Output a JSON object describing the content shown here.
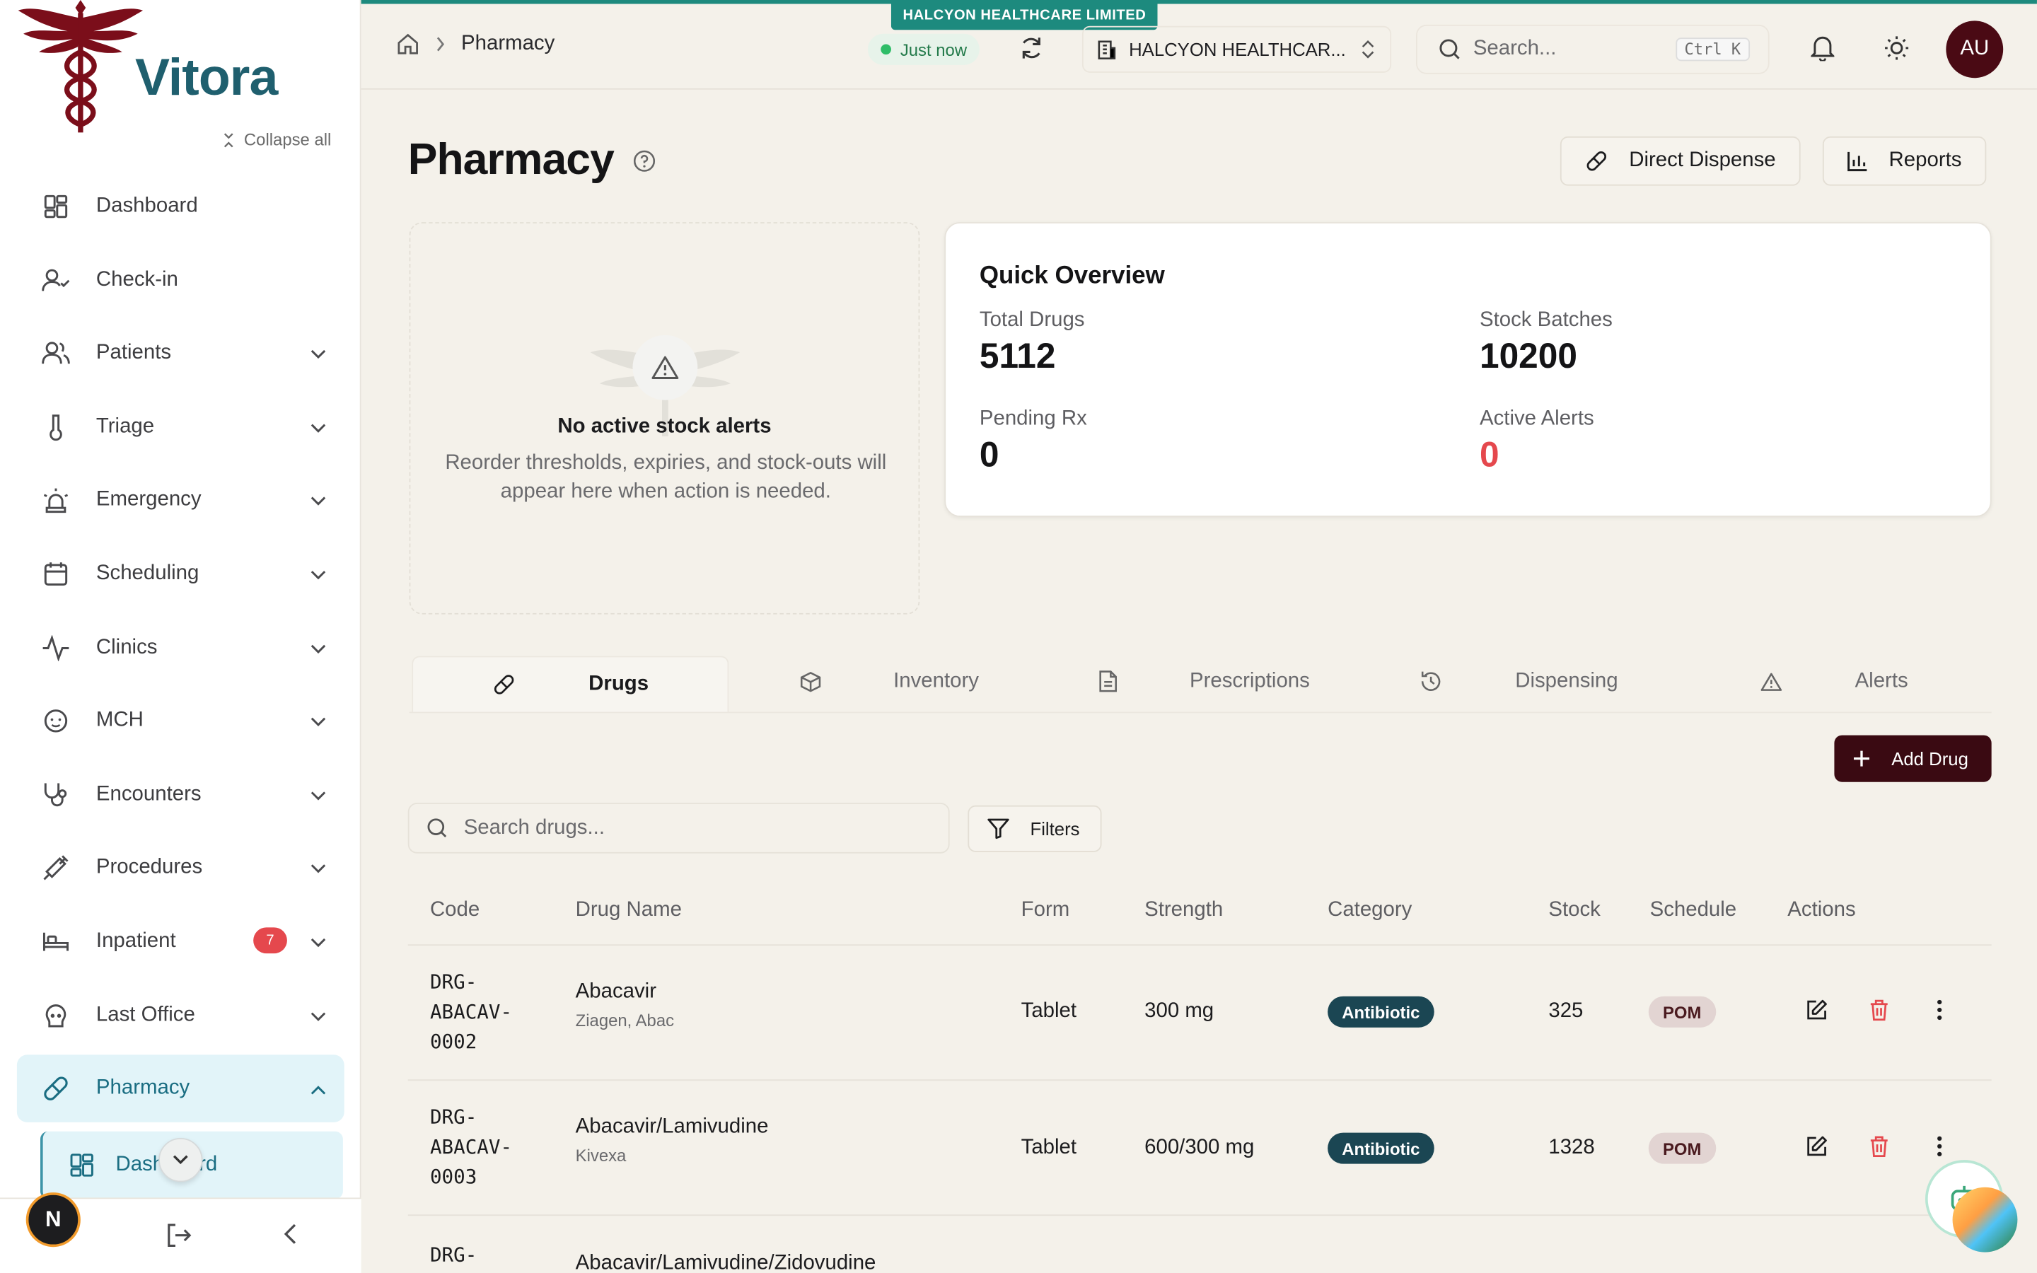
{
  "app": {
    "brand": "Vitora",
    "org_tag": "HALCYON HEALTHCARE LIMITED",
    "colors": {
      "accent": "#1d8a7e",
      "primary": "#3a0a12",
      "danger": "#e5484d",
      "active_nav_bg": "#e2f4f9"
    }
  },
  "sidebar": {
    "collapse_all": "Collapse all",
    "items": [
      {
        "label": "Dashboard",
        "icon": "dashboard-icon",
        "expandable": false
      },
      {
        "label": "Check-in",
        "icon": "user-check-icon",
        "expandable": false
      },
      {
        "label": "Patients",
        "icon": "users-icon",
        "expandable": true
      },
      {
        "label": "Triage",
        "icon": "thermometer-icon",
        "expandable": true
      },
      {
        "label": "Emergency",
        "icon": "siren-icon",
        "expandable": true
      },
      {
        "label": "Scheduling",
        "icon": "calendar-icon",
        "expandable": true
      },
      {
        "label": "Clinics",
        "icon": "pulse-icon",
        "expandable": true
      },
      {
        "label": "MCH",
        "icon": "baby-icon",
        "expandable": true
      },
      {
        "label": "Encounters",
        "icon": "stethoscope-icon",
        "expandable": true
      },
      {
        "label": "Procedures",
        "icon": "syringe-icon",
        "expandable": true
      },
      {
        "label": "Inpatient",
        "icon": "bed-icon",
        "expandable": true,
        "badge": "7"
      },
      {
        "label": "Last Office",
        "icon": "skull-icon",
        "expandable": true
      },
      {
        "label": "Pharmacy",
        "icon": "pill-icon",
        "expandable": true,
        "active": true
      }
    ],
    "subitem": "Dashboard",
    "user_initial": "N"
  },
  "topbar": {
    "breadcrumb": "Pharmacy",
    "sync_status": "Just now",
    "org_select": "HALCYON HEALTHCAR...",
    "search_placeholder": "Search...",
    "search_shortcut": "Ctrl K",
    "user_initials": "AU"
  },
  "page": {
    "title": "Pharmacy",
    "direct_dispense": "Direct Dispense",
    "reports": "Reports"
  },
  "alerts_panel": {
    "heading": "No active stock alerts",
    "body": "Reorder thresholds, expiries, and stock-outs will appear here when action is needed."
  },
  "overview": {
    "heading": "Quick Overview",
    "stats": [
      {
        "label": "Total Drugs",
        "value": "5112"
      },
      {
        "label": "Stock Batches",
        "value": "10200"
      },
      {
        "label": "Pending Rx",
        "value": "0"
      },
      {
        "label": "Active Alerts",
        "value": "0"
      }
    ]
  },
  "tabs": [
    {
      "label": "Drugs",
      "icon": "pill-icon",
      "active": true
    },
    {
      "label": "Inventory",
      "icon": "box-icon"
    },
    {
      "label": "Prescriptions",
      "icon": "document-icon"
    },
    {
      "label": "Dispensing",
      "icon": "history-icon"
    },
    {
      "label": "Alerts",
      "icon": "warning-icon"
    }
  ],
  "toolbar": {
    "add_drug": "Add Drug",
    "search_placeholder": "Search drugs...",
    "filters": "Filters"
  },
  "table": {
    "columns": [
      "Code",
      "Drug Name",
      "Form",
      "Strength",
      "Category",
      "Stock",
      "Schedule",
      "Actions"
    ],
    "rows": [
      {
        "code": [
          "DRG-",
          "ABACAV-",
          "0002"
        ],
        "name": "Abacavir",
        "brand": "Ziagen, Abac",
        "form": "Tablet",
        "strength": "300 mg",
        "category": "Antibiotic",
        "stock": "325",
        "schedule": "POM"
      },
      {
        "code": [
          "DRG-",
          "ABACAV-",
          "0003"
        ],
        "name": "Abacavir/Lamivudine",
        "brand": "Kivexa",
        "form": "Tablet",
        "strength": "600/300 mg",
        "category": "Antibiotic",
        "stock": "1328",
        "schedule": "POM"
      },
      {
        "code": [
          "DRG-"
        ],
        "name": "Abacavir/Lamivudine/Zidovudine",
        "brand": "",
        "form": "",
        "strength": "",
        "category": "",
        "stock": "",
        "schedule": ""
      }
    ]
  }
}
